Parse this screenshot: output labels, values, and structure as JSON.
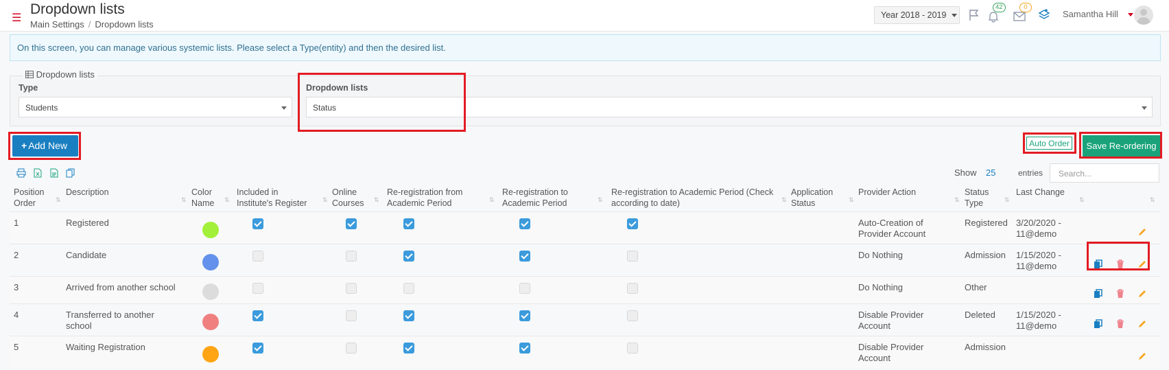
{
  "header": {
    "title": "Dropdown lists",
    "breadcrumb": [
      "Main Settings",
      "Dropdown lists"
    ],
    "year": "Year 2018 - 2019",
    "notifications_count": "42",
    "messages_count": "0",
    "user_name": "Samantha Hill",
    "icons": [
      "menu-icon",
      "flag-icon",
      "bell-icon",
      "envelope-icon",
      "layers-icon"
    ]
  },
  "info_text": "On this screen, you can manage various systemic lists. Please select a Type(entity) and then the desired list.",
  "filter": {
    "legend": "Dropdown lists",
    "type_label": "Type",
    "type_value": "Students",
    "list_label": "Dropdown lists",
    "list_value": "Status"
  },
  "buttons": {
    "add_new": "Add New",
    "auto_order": "Auto Order",
    "save_reordering": "Save Re-ordering"
  },
  "table_controls": {
    "show_label": "Show",
    "show_count": "25",
    "entries_label": "entries",
    "search_placeholder": "Search..."
  },
  "columns": [
    "Position Order",
    "Description",
    "Color Name",
    "Included in Institute's Register",
    "Online Courses",
    "Re-registration from Academic Period",
    "Re-registration to Academic Period",
    "Re-registration to Academic Period (Check according to date)",
    "Application Status",
    "Provider Action",
    "Status Type",
    "Last Change"
  ],
  "colors": {
    "primary": "#1a7fc1",
    "success": "#1aa37a",
    "highlight": "#e31b23"
  },
  "rows": [
    {
      "order": "1",
      "description": "Registered",
      "color": "#a3f03b",
      "included": true,
      "online": true,
      "rereg_from": true,
      "rereg_to": true,
      "rereg_date": true,
      "application_status": "",
      "provider_action": "Auto-Creation of Provider Account",
      "status_type": "Registered",
      "last_change": "3/20/2020 - 11@demo",
      "actions": [
        "edit"
      ]
    },
    {
      "order": "2",
      "description": "Candidate",
      "color": "#6391ec",
      "included": false,
      "online": false,
      "rereg_from": true,
      "rereg_to": true,
      "rereg_date": false,
      "application_status": "",
      "provider_action": "Do Nothing",
      "status_type": "Admission",
      "last_change": "1/15/2020 - 11@demo",
      "actions": [
        "copy",
        "delete",
        "edit"
      ]
    },
    {
      "order": "3",
      "description": "Arrived from another school",
      "color": "#dcdcdc",
      "included": false,
      "online": false,
      "rereg_from": false,
      "rereg_to": false,
      "rereg_date": false,
      "application_status": "",
      "provider_action": "Do Nothing",
      "status_type": "Other",
      "last_change": "",
      "actions": [
        "copy",
        "delete",
        "edit"
      ]
    },
    {
      "order": "4",
      "description": "Transferred to another school",
      "color": "#f08080",
      "included": true,
      "online": false,
      "rereg_from": true,
      "rereg_to": true,
      "rereg_date": false,
      "application_status": "",
      "provider_action": "Disable Provider Account",
      "status_type": "Deleted",
      "last_change": "1/15/2020 - 11@demo",
      "actions": [
        "copy",
        "delete",
        "edit"
      ]
    },
    {
      "order": "5",
      "description": "Waiting Registration",
      "color": "#ffa514",
      "included": true,
      "online": false,
      "rereg_from": true,
      "rereg_to": true,
      "rereg_date": false,
      "application_status": "",
      "provider_action": "Disable Provider Account",
      "status_type": "Admission",
      "last_change": "",
      "actions": [
        "edit"
      ]
    }
  ]
}
